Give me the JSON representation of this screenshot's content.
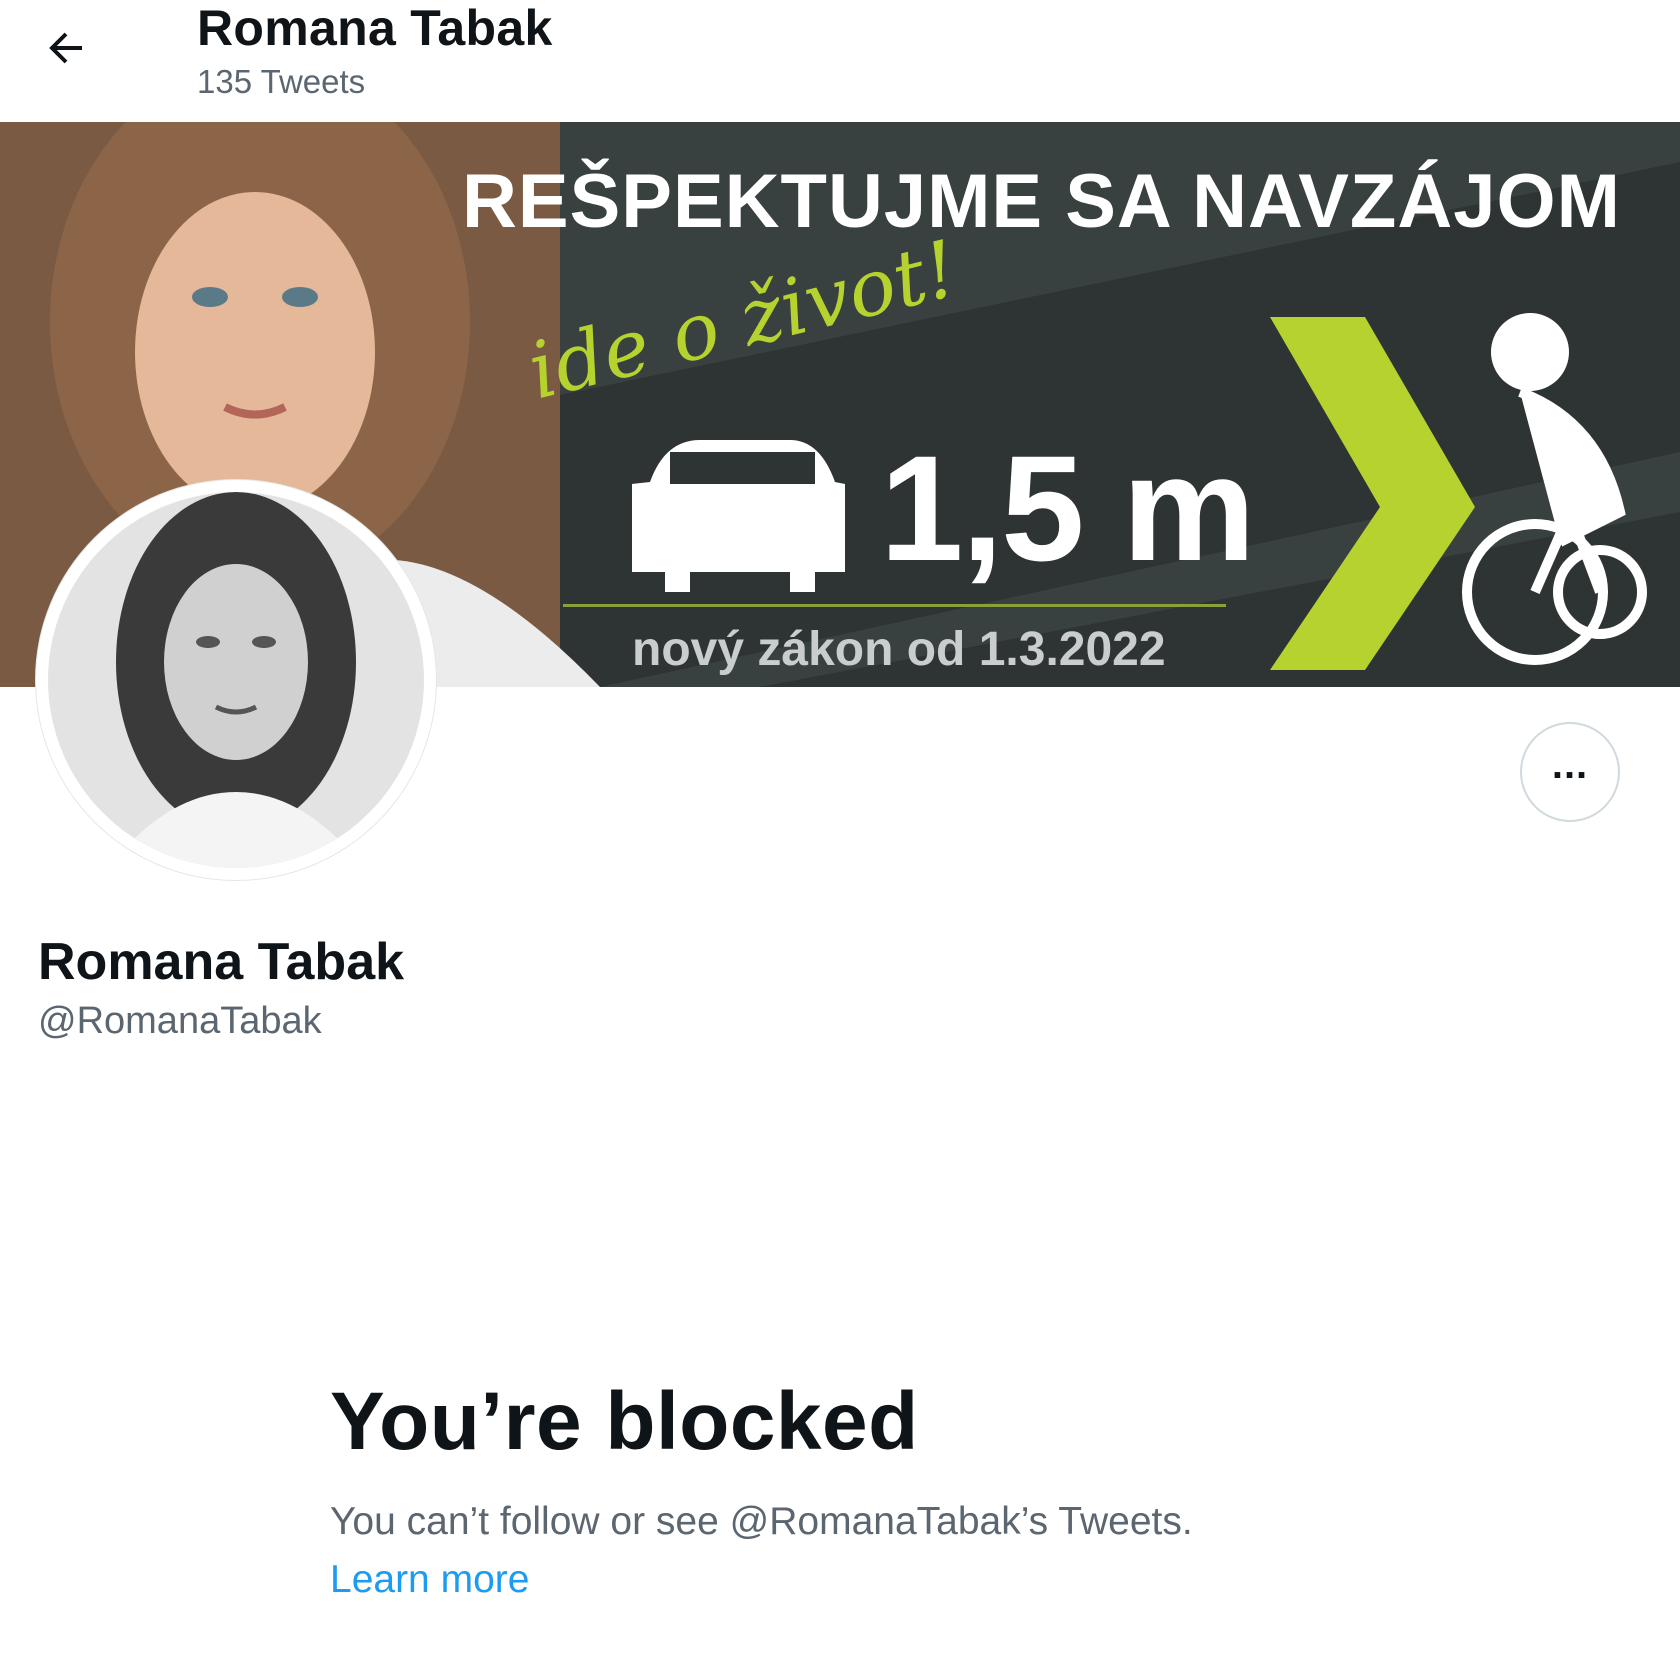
{
  "header": {
    "back_icon": "arrow-left-icon",
    "name": "Romana Tabak",
    "tweet_count": "135 Tweets"
  },
  "banner": {
    "headline": "REŠPEKTUJME SA NAVZÁJOM",
    "slogan": "ide o život!",
    "distance": "1,5 m",
    "law_text": "nový zákon od 1.3.2022",
    "accent_color": "#b6d22e",
    "background_color": "#2c3232"
  },
  "profile": {
    "display_name": "Romana Tabak",
    "handle": "@RomanaTabak",
    "more_icon": "more-horizontal-icon"
  },
  "blocked": {
    "title": "You’re blocked",
    "description": "You can’t follow or see @RomanaTabak’s Tweets.",
    "learn_more": "Learn more",
    "link_color": "#1d9bf0"
  }
}
